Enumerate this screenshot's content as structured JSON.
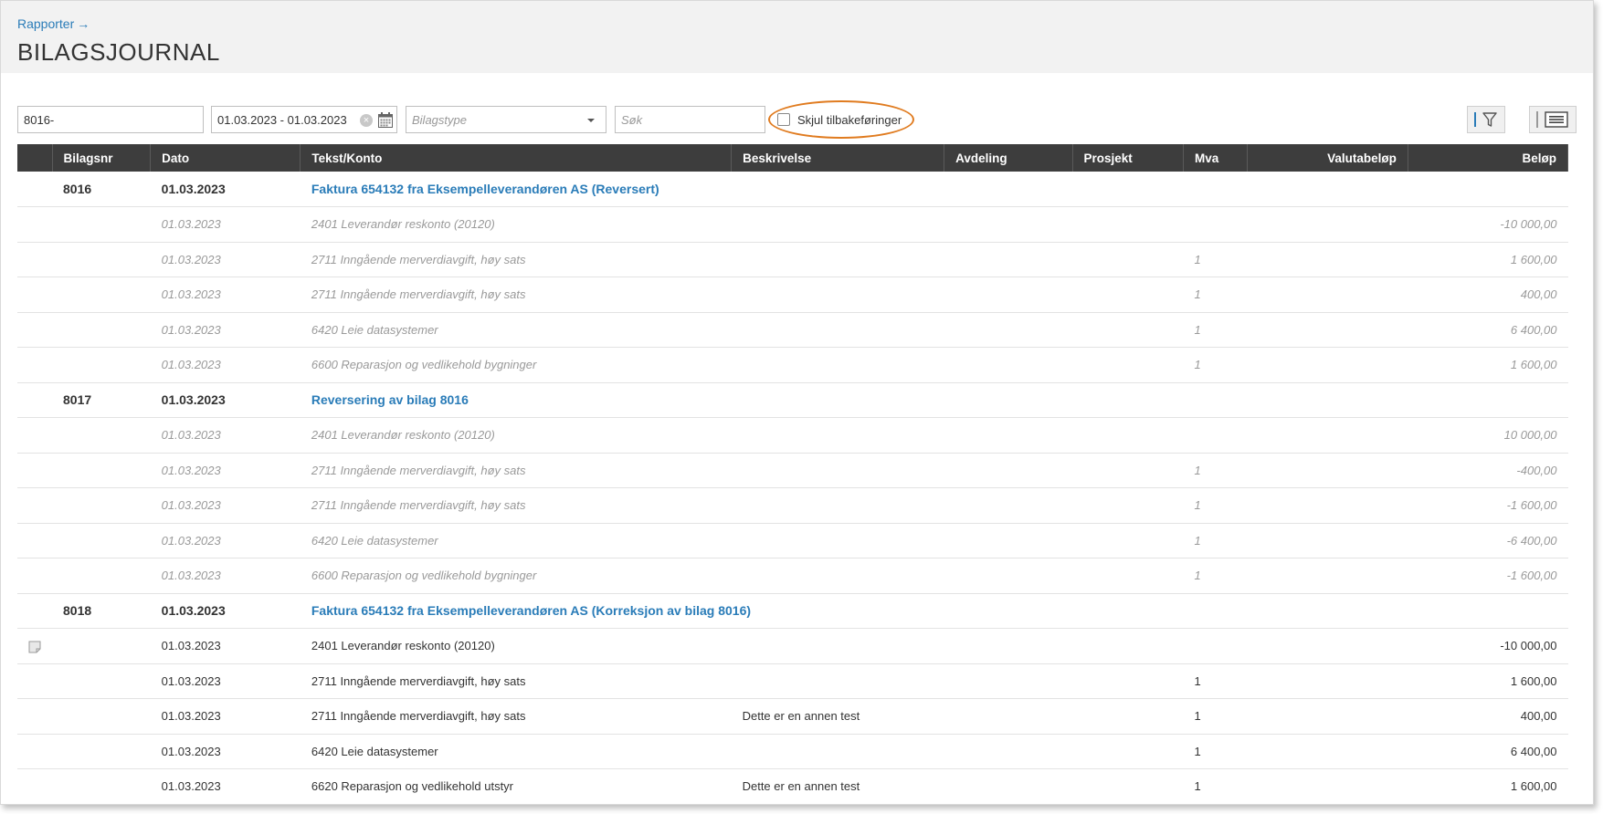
{
  "breadcrumb": {
    "label": "Rapporter",
    "arrow": "→"
  },
  "page_title": "BILAGSJOURNAL",
  "filters": {
    "voucher_range": "8016-",
    "date_range": "01.03.2023 - 01.03.2023",
    "voucher_type_placeholder": "Bilagstype",
    "search_placeholder": "Søk",
    "hide_reversals_label": "Skjul tilbakeføringer",
    "hide_reversals_checked": false
  },
  "colors": {
    "accent": "#2a7cb8",
    "highlight": "#e07b1f",
    "header_bg": "#3d3d3d"
  },
  "columns": {
    "c0": "",
    "bilagsnr": "Bilagsnr",
    "dato": "Dato",
    "tekst": "Tekst/Konto",
    "beskrivelse": "Beskrivelse",
    "avdeling": "Avdeling",
    "prosjekt": "Prosjekt",
    "mva": "Mva",
    "valutabelop": "Valutabeløp",
    "belop": "Beløp"
  },
  "vouchers": [
    {
      "number": "8016",
      "date": "01.03.2023",
      "title": "Faktura 654132 fra Eksempelleverandøren AS (Reversert)",
      "style": "reversed",
      "lines": [
        {
          "date": "01.03.2023",
          "account": "2401 Leverandør reskonto (20120)",
          "description": "",
          "mva": "",
          "amount": "-10 000,00"
        },
        {
          "date": "01.03.2023",
          "account": "2711 Inngående merverdiavgift, høy sats",
          "description": "",
          "mva": "1",
          "amount": "1 600,00"
        },
        {
          "date": "01.03.2023",
          "account": "2711 Inngående merverdiavgift, høy sats",
          "description": "",
          "mva": "1",
          "amount": "400,00"
        },
        {
          "date": "01.03.2023",
          "account": "6420 Leie datasystemer",
          "description": "",
          "mva": "1",
          "amount": "6 400,00"
        },
        {
          "date": "01.03.2023",
          "account": "6600 Reparasjon og vedlikehold bygninger",
          "description": "",
          "mva": "1",
          "amount": "1 600,00"
        }
      ]
    },
    {
      "number": "8017",
      "date": "01.03.2023",
      "title": "Reversering av bilag 8016",
      "style": "reversed",
      "lines": [
        {
          "date": "01.03.2023",
          "account": "2401 Leverandør reskonto (20120)",
          "description": "",
          "mva": "",
          "amount": "10 000,00"
        },
        {
          "date": "01.03.2023",
          "account": "2711 Inngående merverdiavgift, høy sats",
          "description": "",
          "mva": "1",
          "amount": "-400,00"
        },
        {
          "date": "01.03.2023",
          "account": "2711 Inngående merverdiavgift, høy sats",
          "description": "",
          "mva": "1",
          "amount": "-1 600,00"
        },
        {
          "date": "01.03.2023",
          "account": "6420 Leie datasystemer",
          "description": "",
          "mva": "1",
          "amount": "-6 400,00"
        },
        {
          "date": "01.03.2023",
          "account": "6600 Reparasjon og vedlikehold bygninger",
          "description": "",
          "mva": "1",
          "amount": "-1 600,00"
        }
      ]
    },
    {
      "number": "8018",
      "date": "01.03.2023",
      "title": "Faktura 654132 fra Eksempelleverandøren AS (Korreksjon av bilag 8016)",
      "style": "normal",
      "lines": [
        {
          "date": "01.03.2023",
          "account": "2401 Leverandør reskonto (20120)",
          "description": "",
          "mva": "",
          "amount": "-10 000,00",
          "note_icon": "note-icon"
        },
        {
          "date": "01.03.2023",
          "account": "2711 Inngående merverdiavgift, høy sats",
          "description": "",
          "mva": "1",
          "amount": "1 600,00"
        },
        {
          "date": "01.03.2023",
          "account": "2711 Inngående merverdiavgift, høy sats",
          "description": "Dette er en annen test",
          "mva": "1",
          "amount": "400,00"
        },
        {
          "date": "01.03.2023",
          "account": "6420 Leie datasystemer",
          "description": "",
          "mva": "1",
          "amount": "6 400,00"
        },
        {
          "date": "01.03.2023",
          "account": "6620 Reparasjon og vedlikehold utstyr",
          "description": "Dette er en annen test",
          "mva": "1",
          "amount": "1 600,00"
        }
      ]
    }
  ]
}
